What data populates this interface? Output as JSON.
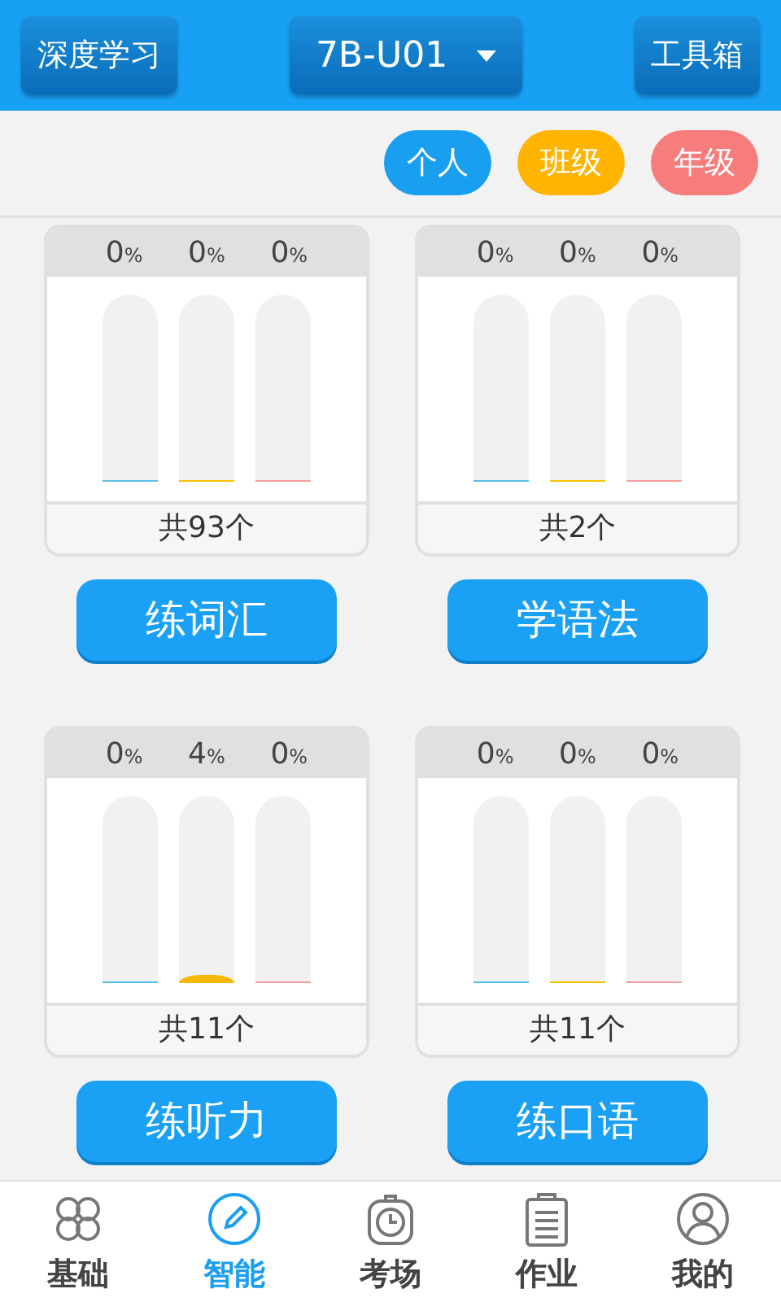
{
  "header": {
    "left_button": "深度学习",
    "unit_select": "7B-U01",
    "right_button": "工具箱"
  },
  "filters": [
    {
      "label": "个人",
      "color": "#1a9ef0"
    },
    {
      "label": "班级",
      "color": "#ffb400"
    },
    {
      "label": "年级",
      "color": "#f77d7d"
    }
  ],
  "modules": [
    {
      "bars": [
        {
          "value": "0",
          "unit": "%",
          "level": 0,
          "color": "#5bc0eb"
        },
        {
          "value": "0",
          "unit": "%",
          "level": 0,
          "color": "#f6c400"
        },
        {
          "value": "0",
          "unit": "%",
          "level": 0,
          "color": "#f3a0a0"
        }
      ],
      "total": "共93个",
      "button": "练词汇"
    },
    {
      "bars": [
        {
          "value": "0",
          "unit": "%",
          "level": 0,
          "color": "#5bc0eb"
        },
        {
          "value": "0",
          "unit": "%",
          "level": 0,
          "color": "#f6c400"
        },
        {
          "value": "0",
          "unit": "%",
          "level": 0,
          "color": "#f3a0a0"
        }
      ],
      "total": "共2个",
      "button": "学语法"
    },
    {
      "bars": [
        {
          "value": "0",
          "unit": "%",
          "level": 0,
          "color": "#5bc0eb"
        },
        {
          "value": "4",
          "unit": "%",
          "level": 0.04,
          "color": "#f6b800"
        },
        {
          "value": "0",
          "unit": "%",
          "level": 0,
          "color": "#f3a0a0"
        }
      ],
      "total": "共11个",
      "button": "练听力"
    },
    {
      "bars": [
        {
          "value": "0",
          "unit": "%",
          "level": 0,
          "color": "#5bc0eb"
        },
        {
          "value": "0",
          "unit": "%",
          "level": 0,
          "color": "#f6c400"
        },
        {
          "value": "0",
          "unit": "%",
          "level": 0,
          "color": "#f3a0a0"
        }
      ],
      "total": "共11个",
      "button": "练口语"
    }
  ],
  "tab_bar": [
    {
      "label": "基础",
      "selected": false
    },
    {
      "label": "智能",
      "selected": true
    },
    {
      "label": "考场",
      "selected": false
    },
    {
      "label": "作业",
      "selected": false
    },
    {
      "label": "我的",
      "selected": false
    }
  ]
}
